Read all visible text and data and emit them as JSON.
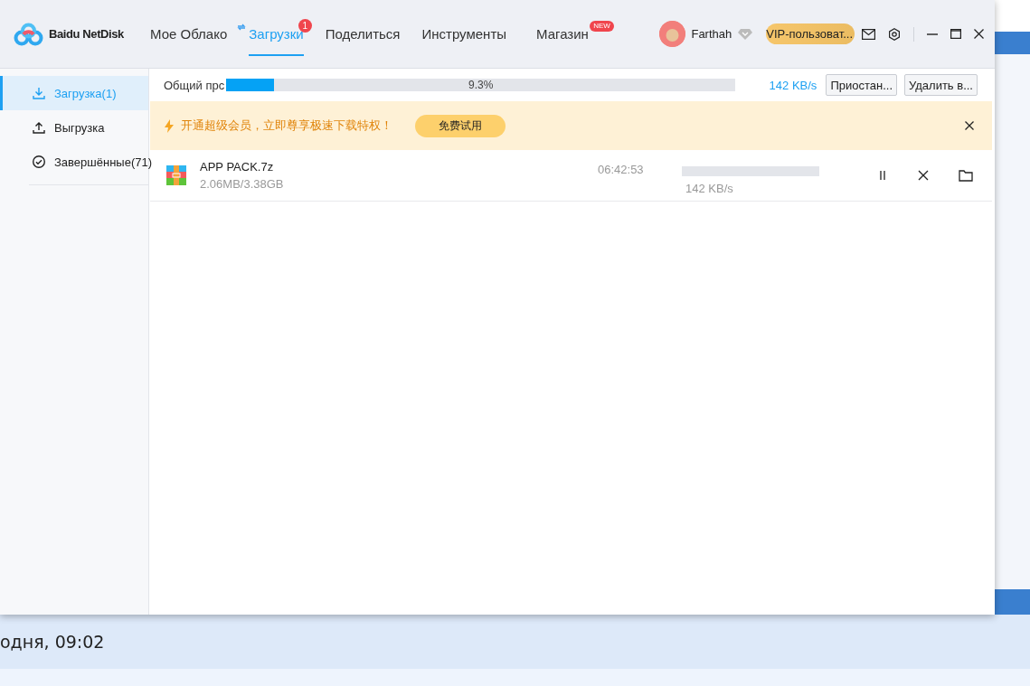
{
  "window": {
    "logo": "Baidu NetDisk"
  },
  "nav_tabs": [
    {
      "label": "Мое Облако",
      "selected": false,
      "transferring": false
    },
    {
      "label": "Загрузки",
      "selected": true,
      "transferring": true,
      "badge": "1"
    },
    {
      "label": "Поделиться",
      "selected": false,
      "transferring": false
    },
    {
      "label": "Инструменты",
      "selected": false,
      "transferring": false
    },
    {
      "label": "Магазин",
      "selected": false,
      "transferring": false,
      "badge": "NEW"
    }
  ],
  "user": {
    "name": "Farthah",
    "vip_button": "VIP-пользоват..."
  },
  "sidebar": {
    "items": [
      {
        "label": "Загрузка(1)",
        "selected": true,
        "kind": "download"
      },
      {
        "label": "Выгрузка",
        "selected": false,
        "kind": "upload"
      },
      {
        "label": "Завершённые(71)",
        "selected": false,
        "kind": "done"
      }
    ]
  },
  "overall": {
    "label": "Общий прс",
    "level": 0.093,
    "percent": "9.3%",
    "speed": "142 KB/s",
    "buttons": [
      "Приостан...",
      "Удалить в..."
    ]
  },
  "promo": {
    "text": "开通超级会员，立即尊享极速下载特权！",
    "button": "免费试用"
  },
  "downloads": [
    {
      "name": "APP PACK.7z",
      "size": "2.06MB/3.38GB",
      "time_left": "06:42:53",
      "speed": "142 KB/s"
    }
  ],
  "background_page": {
    "timestamp": "одня, 09:02"
  }
}
